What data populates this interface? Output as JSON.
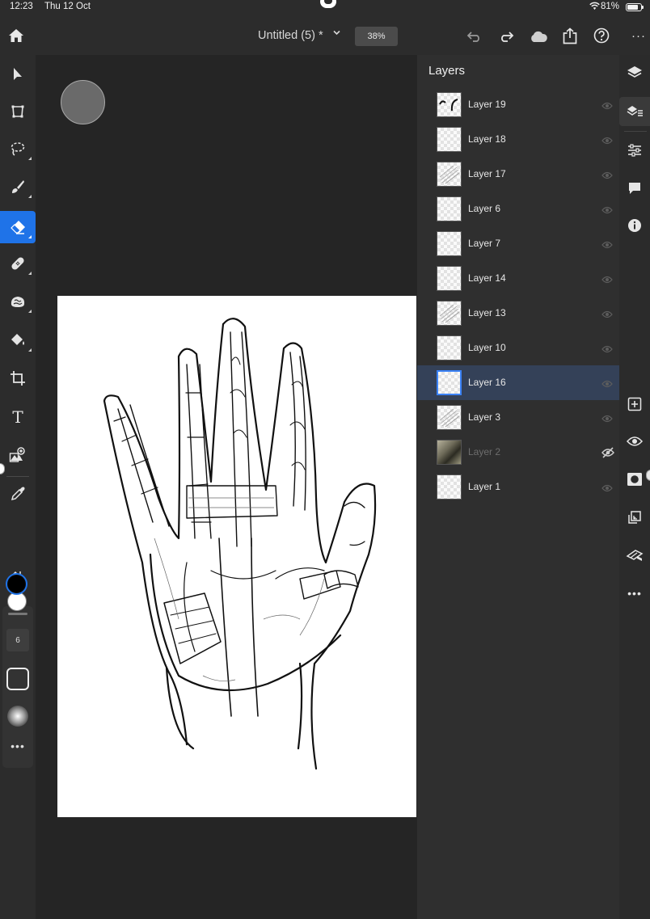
{
  "status_bar": {
    "time": "12:23",
    "date": "Thu 12 Oct",
    "battery": "81%"
  },
  "app_bar": {
    "document_title": "Untitled (5) *",
    "zoom": "38%",
    "icons": [
      "home-icon",
      "chevron-down-icon",
      "undo-icon",
      "redo-icon",
      "cloud-icon",
      "share-icon",
      "help-icon",
      "more-icon"
    ]
  },
  "toolbar": {
    "tools": [
      "select",
      "transform",
      "lasso",
      "brush",
      "eraser",
      "healing",
      "clone",
      "fill",
      "crop",
      "type",
      "place-image",
      "eyedropper"
    ],
    "active_tool": "eraser",
    "foreground_color": "#000000",
    "background_color": "#ffffff",
    "brush_size": "6"
  },
  "layers": {
    "title": "Layers",
    "items": [
      {
        "name": "Layer 19",
        "visible": true,
        "selected": false
      },
      {
        "name": "Layer 18",
        "visible": true,
        "selected": false
      },
      {
        "name": "Layer 17",
        "visible": true,
        "selected": false
      },
      {
        "name": "Layer 6",
        "visible": true,
        "selected": false
      },
      {
        "name": "Layer 7",
        "visible": true,
        "selected": false
      },
      {
        "name": "Layer 14",
        "visible": true,
        "selected": false
      },
      {
        "name": "Layer 13",
        "visible": true,
        "selected": false
      },
      {
        "name": "Layer 10",
        "visible": true,
        "selected": false
      },
      {
        "name": "Layer 16",
        "visible": true,
        "selected": true
      },
      {
        "name": "Layer 3",
        "visible": true,
        "selected": false
      },
      {
        "name": "Layer 2",
        "visible": false,
        "selected": false
      },
      {
        "name": "Layer 1",
        "visible": true,
        "selected": false
      }
    ]
  },
  "right_rail": {
    "icons": [
      "layers-icon",
      "layer-properties-icon",
      "adjustments-icon",
      "comments-icon",
      "info-icon",
      "add-layer-icon",
      "visibility-icon",
      "mask-icon",
      "clipping-icon",
      "eraser-layer-icon",
      "more-icon"
    ]
  },
  "colors": {
    "accent": "#1f73e8",
    "selected_row": "#344158",
    "panel": "#2f2f2f",
    "canvas_bg": "#252525"
  }
}
